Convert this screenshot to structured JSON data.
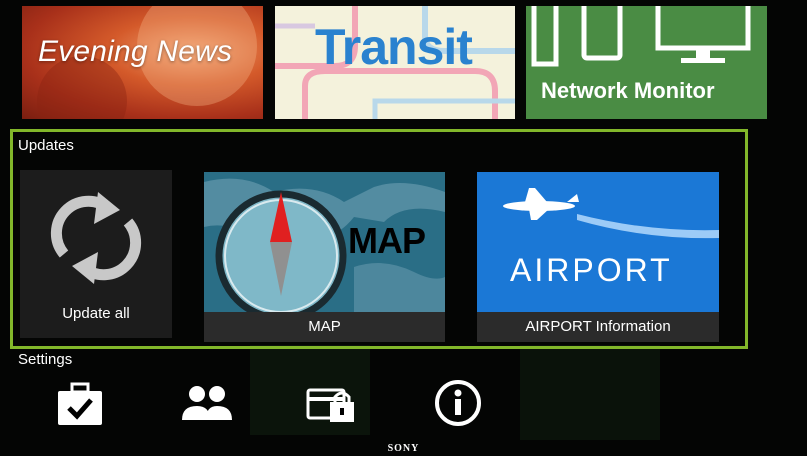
{
  "top_tiles": {
    "news_title": "Evening News",
    "transit_title": "Transit",
    "network_title": "Network Monitor"
  },
  "updates": {
    "section_label": "Updates",
    "update_all_label": "Update all",
    "map_tile_text": "MAP",
    "map_caption": "MAP",
    "airport_tile_text": "AIRPORT",
    "airport_caption": "AIRPORT Information"
  },
  "settings": {
    "section_label": "Settings",
    "icons": [
      "briefcase-check-icon",
      "people-icon",
      "wallet-lock-icon",
      "info-icon"
    ]
  },
  "brand": "SONY",
  "colors": {
    "focus_border": "#82b72a",
    "news_bg": "#c94a22",
    "transit_bg": "#f4f2dc",
    "transit_text": "#2a82cf",
    "network_bg": "#4a8c44",
    "map_bg": "#2a6e86",
    "airport_bg": "#1b78d6",
    "caption_bg": "#2b2b2b"
  }
}
